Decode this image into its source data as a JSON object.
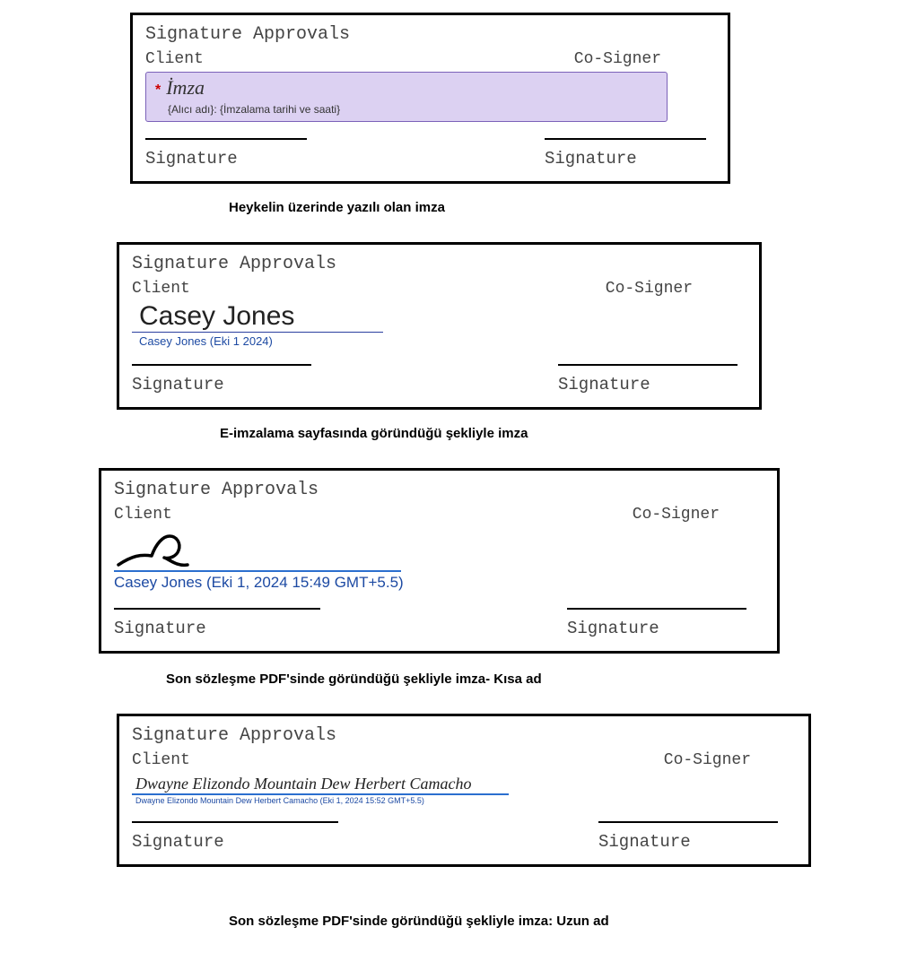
{
  "panel1": {
    "title": "Signature Approvals",
    "client_label": "Client",
    "cosigner_label": "Co-Signer",
    "field_required_mark": "*",
    "field_label": "İmza",
    "field_substitution": "{Alıcı adı}: {İmzalama tarihi ve saati}",
    "signature_caption_left": "Signature",
    "signature_caption_right": "Signature"
  },
  "caption1": "Heykelin üzerinde yazılı olan imza",
  "panel2": {
    "title": "Signature Approvals",
    "client_label": "Client",
    "cosigner_label": "Co-Signer",
    "signed_name": "Casey Jones",
    "signed_meta": "Casey Jones    (Eki 1 2024)",
    "signature_caption_left": "Signature",
    "signature_caption_right": "Signature"
  },
  "caption2": "E-imzalama sayfasında göründüğü şekliyle imza",
  "panel3": {
    "title": "Signature Approvals",
    "client_label": "Client",
    "cosigner_label": "Co-Signer",
    "signed_meta": "Casey  Jones (Eki 1, 2024 15:49 GMT+5.5)",
    "signature_caption_left": "Signature",
    "signature_caption_right": "Signature"
  },
  "caption3": "Son sözleşme PDF'sinde göründüğü şekliyle imza- Kısa ad",
  "panel4": {
    "title": "Signature Approvals",
    "client_label": "Client",
    "cosigner_label": "Co-Signer",
    "signed_name": "Dwayne Elizondo Mountain Dew Herbert Camacho",
    "signed_meta": "Dwayne Elizondo Mountain Dew Herbert Camacho (Eki 1, 2024 15:52 GMT+5.5)",
    "signature_caption_left": "Signature",
    "signature_caption_right": "Signature"
  },
  "caption4": "Son sözleşme PDF'sinde göründüğü şekliyle imza: Uzun ad"
}
